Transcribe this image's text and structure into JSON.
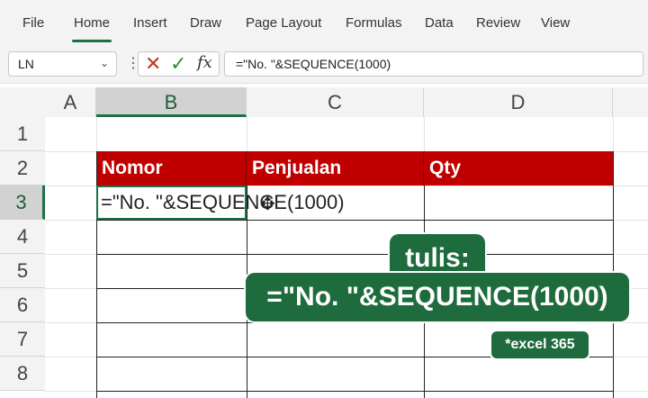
{
  "menu": {
    "items": [
      "File",
      "Home",
      "Insert",
      "Draw",
      "Page Layout",
      "Formulas",
      "Data",
      "Review",
      "View"
    ],
    "active": "Home"
  },
  "formula_bar": {
    "name_box": "LN",
    "formula": "=\"No. \"&SEQUENCE(1000)",
    "fx_label": "fx",
    "cancel_icon": "close-icon",
    "enter_icon": "check-icon"
  },
  "grid": {
    "columns": [
      "A",
      "B",
      "C",
      "D"
    ],
    "rows": [
      "1",
      "2",
      "3",
      "4",
      "5",
      "6",
      "7",
      "8"
    ],
    "selected_column": "B",
    "selected_row": "3"
  },
  "table": {
    "headers": [
      "Nomor",
      "Penjualan",
      "Qty"
    ],
    "header_color": "#c00000",
    "editing_cell_text": "=\"No. \"&SEQUENCE(1000)"
  },
  "callout": {
    "label": "tulis:",
    "formula": "=\"No. \"&SEQUENCE(1000)",
    "note": "*excel 365",
    "color": "#1e6b3d"
  }
}
